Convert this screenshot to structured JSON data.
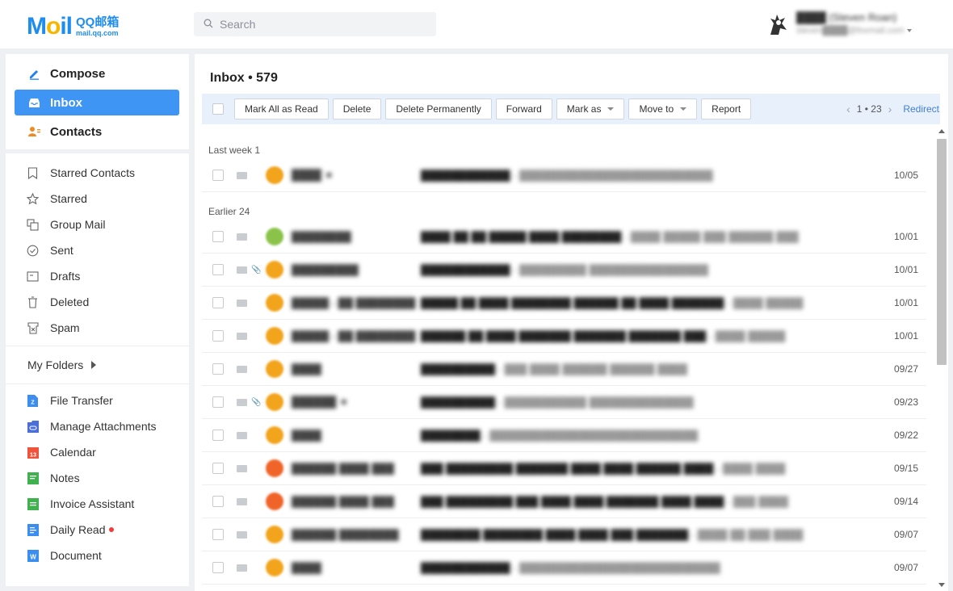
{
  "app": {
    "logo_word": "Mail",
    "logo_title": "QQ邮箱",
    "logo_sub": "mail.qq.com"
  },
  "search": {
    "placeholder": "Search"
  },
  "user": {
    "name": "████ (Steven Roan)",
    "email": "steven████@foxmail.com"
  },
  "nav_top": [
    {
      "label": "Compose",
      "icon": "pencil-icon",
      "color": "#1e7ff0"
    },
    {
      "label": "Inbox",
      "icon": "inbox-icon",
      "active": true
    },
    {
      "label": "Contacts",
      "icon": "contacts-icon",
      "color": "#f08a1e"
    }
  ],
  "nav_system": [
    {
      "label": "Starred Contacts",
      "icon": "bookmark-icon"
    },
    {
      "label": "Starred",
      "icon": "star-icon"
    },
    {
      "label": "Group Mail",
      "icon": "group-mail-icon"
    },
    {
      "label": "Sent",
      "icon": "sent-icon"
    },
    {
      "label": "Drafts",
      "icon": "drafts-icon"
    },
    {
      "label": "Deleted",
      "icon": "trash-icon"
    },
    {
      "label": "Spam",
      "icon": "spam-icon"
    }
  ],
  "my_folders": "My Folders",
  "nav_apps": [
    {
      "label": "File Transfer",
      "icon": "file-transfer-icon",
      "color": "#3b8ef0"
    },
    {
      "label": "Manage Attachments",
      "icon": "attachments-icon",
      "color": "#4a6fd8"
    },
    {
      "label": "Calendar",
      "icon": "calendar-icon",
      "color": "#f0533b"
    },
    {
      "label": "Notes",
      "icon": "notes-icon",
      "color": "#3fb24f"
    },
    {
      "label": "Invoice Assistant",
      "icon": "invoice-icon",
      "color": "#3fb24f"
    },
    {
      "label": "Daily Read",
      "icon": "daily-read-icon",
      "color": "#3b8ef0",
      "badge": true
    },
    {
      "label": "Document",
      "icon": "document-icon",
      "color": "#3b8ef0"
    }
  ],
  "inbox": {
    "title": "Inbox • 579",
    "toolbar": {
      "mark_all_read": "Mark All as Read",
      "delete": "Delete",
      "delete_permanently": "Delete Permanently",
      "forward": "Forward",
      "mark_as": "Mark as",
      "move_to": "Move to",
      "report": "Report"
    },
    "pager": {
      "text": "1 • 23",
      "redirect": "Redirect"
    },
    "groups": [
      {
        "label": "Last week 1",
        "messages": [
          {
            "sender": "████ ★",
            "subject": "████████████",
            "preview": " - ██████████████████████████",
            "date": "10/05",
            "avatar_color": "#f2a41c",
            "attachment": false
          }
        ]
      },
      {
        "label": "Earlier 24",
        "messages": [
          {
            "sender": "████████",
            "subject": "████ ██ ██ █████ ████ ████████",
            "preview": " - ████ █████ ███ ██████ ███",
            "date": "10/01",
            "avatar_color": "#8bc34a",
            "attachment": false
          },
          {
            "sender": "█████████",
            "subject": "████████████",
            "preview": " - █████████ ████████████████",
            "date": "10/01",
            "avatar_color": "#f2a41c",
            "attachment": true
          },
          {
            "sender": "█████ - ██ ████████",
            "subject": "█████ ██ ████ ████████ ██████ ██ ████ ███████",
            "preview": " - ████ █████",
            "date": "10/01",
            "avatar_color": "#f2a41c",
            "attachment": false
          },
          {
            "sender": "█████ - ██ ████████",
            "subject": "██████ ██ ████ ███████ ███████ ███████ ███",
            "preview": " - ████ █████",
            "date": "10/01",
            "avatar_color": "#f2a41c",
            "attachment": false
          },
          {
            "sender": "████",
            "subject": "██████████",
            "preview": " - ███ ████ ██████ ██████ ████",
            "date": "09/27",
            "avatar_color": "#f2a41c",
            "attachment": false
          },
          {
            "sender": "██████ ★",
            "subject": "██████████",
            "preview": " - ███████████ ██████████████",
            "date": "09/23",
            "avatar_color": "#f2a41c",
            "attachment": true
          },
          {
            "sender": "████",
            "subject": "████████",
            "preview": " - ████████████████████████████",
            "date": "09/22",
            "avatar_color": "#f2a41c",
            "attachment": false
          },
          {
            "sender": "██████ ████ ███",
            "subject": "███ █████████ ███████ ████ ████ ██████ ████",
            "preview": " - ████ ████",
            "date": "09/15",
            "avatar_color": "#f0642a",
            "attachment": false
          },
          {
            "sender": "██████ ████ ███",
            "subject": "███ █████████ ███ ████ ████ ███████ ████ ████",
            "preview": " - ███ ████",
            "date": "09/14",
            "avatar_color": "#f0642a",
            "attachment": false
          },
          {
            "sender": "██████ ████████",
            "subject": "████████ ████████ ████ ████ ███ ███████",
            "preview": " - ████ ██ ███ ████",
            "date": "09/07",
            "avatar_color": "#f2a41c",
            "attachment": false
          },
          {
            "sender": "████",
            "subject": "████████████",
            "preview": " - ███████████████████████████",
            "date": "09/07",
            "avatar_color": "#f2a41c",
            "attachment": false
          }
        ]
      }
    ]
  }
}
